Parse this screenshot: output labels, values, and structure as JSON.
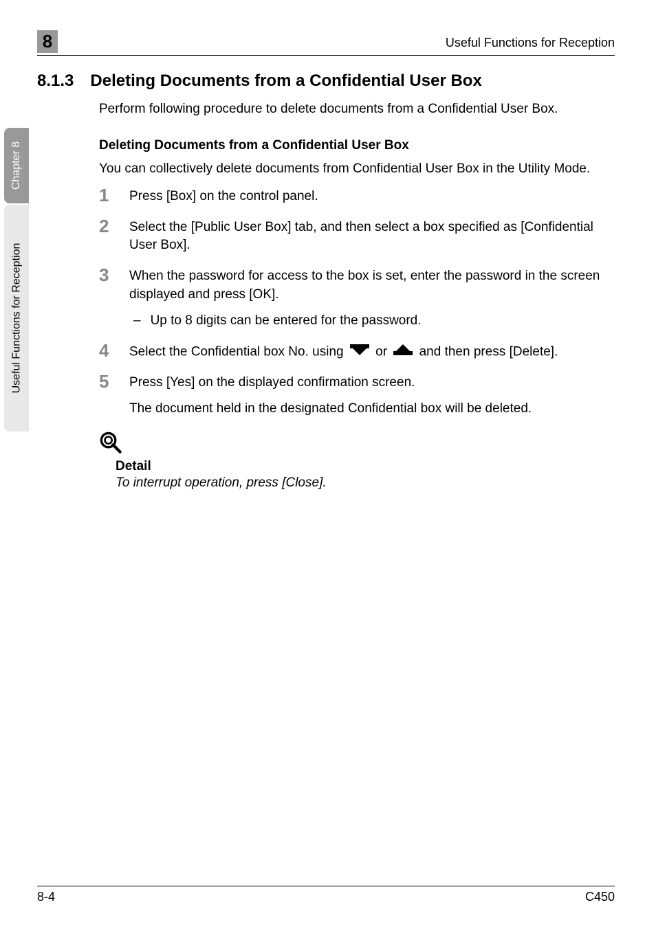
{
  "header": {
    "chapter_num": "8",
    "running_head": "Useful Functions for Reception"
  },
  "side": {
    "top": "Chapter 8",
    "bottom": "Useful Functions for Reception"
  },
  "section": {
    "number": "8.1.3",
    "title": "Deleting Documents from a Confidential User Box",
    "intro": "Perform following procedure to delete documents from a Confidential User Box."
  },
  "sub": {
    "heading": "Deleting Documents from a Confidential User Box",
    "intro": "You can collectively delete documents from Confidential User Box in the Utility Mode."
  },
  "steps": [
    {
      "num": "1",
      "text": "Press [Box] on the control panel."
    },
    {
      "num": "2",
      "text": "Select the [Public User Box] tab, and then select a box specified as [Confidential User Box]."
    },
    {
      "num": "3",
      "text": "When the password for access to the box is set, enter the password in the screen displayed and press [OK].",
      "bullet": "Up to 8 digits can be entered for the password."
    },
    {
      "num": "4",
      "pre": "Select the Confidential box No. using ",
      "mid": " or ",
      "post": " and then press [Delete]."
    },
    {
      "num": "5",
      "text": "Press [Yes] on the displayed confirmation screen.",
      "result": "The document held in the designated Confidential box will be deleted."
    }
  ],
  "detail": {
    "label": "Detail",
    "text": "To interrupt operation, press [Close]."
  },
  "footer": {
    "left": "8-4",
    "right": "C450"
  }
}
